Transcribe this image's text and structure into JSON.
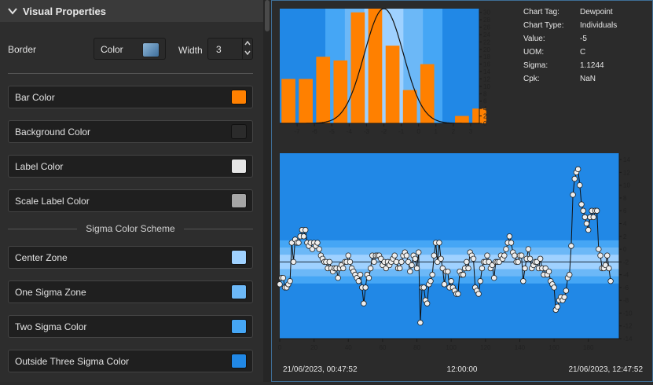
{
  "panel": {
    "title": "Visual Properties",
    "border_label": "Border",
    "border_type": "Color",
    "width_label": "Width",
    "width_value": "3"
  },
  "colors": [
    {
      "label": "Bar Color",
      "color": "#ff8000"
    },
    {
      "label": "Background Color",
      "color": "#2b2b2b"
    },
    {
      "label": "Label Color",
      "color": "#e6e6e6"
    },
    {
      "label": "Scale Label Color",
      "color": "#a6a6a6"
    }
  ],
  "sigma_section": "Sigma Color Scheme",
  "sigma_colors": [
    {
      "label": "Center Zone",
      "color": "#9fd1ff"
    },
    {
      "label": "One Sigma Zone",
      "color": "#6cb8f7"
    },
    {
      "label": "Two Sigma Color",
      "color": "#45a6f5"
    },
    {
      "label": "Outside Three Sigma Color",
      "color": "#2188e6"
    }
  ],
  "info": [
    {
      "key": "Chart Tag:",
      "value": "Dewpoint"
    },
    {
      "key": "Chart Type:",
      "value": "Individuals"
    },
    {
      "key": "Value:",
      "value": "-5"
    },
    {
      "key": "UOM:",
      "value": "C"
    },
    {
      "key": "Sigma:",
      "value": "1.1244"
    },
    {
      "key": "Cpk:",
      "value": "NaN"
    }
  ],
  "time_labels": [
    "21/06/2023, 00:47:52",
    "12:00:00",
    "21/06/2023, 12:47:52"
  ],
  "chart_data": [
    {
      "type": "bar",
      "categories": [
        "-7.5",
        "-6.5",
        "-5.5",
        "-4.5",
        "-3.5",
        "-2.5",
        "-1.5",
        "-0.5",
        "0.5",
        "1.5",
        "2.5",
        "3.5"
      ],
      "values": [
        12,
        12,
        18,
        17,
        30,
        31,
        21,
        9,
        16,
        0,
        2,
        4
      ],
      "x_ticks": [
        -7,
        -6,
        -5,
        -4,
        -3,
        -2,
        -1,
        0,
        1,
        2,
        3
      ],
      "y_ticks": [
        0,
        2,
        4,
        6,
        8,
        10,
        12,
        14,
        16,
        18,
        20,
        22,
        24,
        26,
        28,
        30
      ],
      "xlim": [
        -8,
        3.5
      ],
      "ylim": [
        0,
        31
      ],
      "normal_curve": {
        "mean": -2,
        "sigma": 1.1244,
        "peak": 31
      },
      "bar_color": "#ff8000"
    },
    {
      "type": "line",
      "x_ticks": [
        0,
        20,
        40,
        60,
        80,
        100,
        120,
        140,
        160,
        180
      ],
      "y_ticks": [
        14,
        12,
        10,
        8,
        6,
        4,
        2,
        0,
        -2,
        -4,
        -6,
        -8,
        -10,
        -12,
        -14
      ],
      "xlim": [
        0,
        198
      ],
      "ylim": [
        -14,
        15
      ],
      "center_line": -2,
      "sigma": 1.1244,
      "y": [
        -5.5,
        -4.5,
        -4.5,
        -6,
        -6,
        -5.5,
        -5,
        1,
        -2,
        1.5,
        1,
        1,
        2,
        3,
        2,
        3,
        1,
        0.5,
        1,
        0,
        1,
        0.5,
        1,
        0,
        -1,
        -1.5,
        -2,
        -2,
        -3,
        -2,
        -3,
        -3.5,
        -3,
        -3,
        -4.5,
        -3,
        -2.5,
        -3,
        -2,
        -2,
        -1,
        -2,
        -3,
        -3.5,
        -4,
        -4.5,
        -5,
        -4,
        -6,
        -8.5,
        -6,
        -4,
        -4.5,
        -3,
        -1,
        -2,
        -1,
        -1,
        -1,
        -1.5,
        -2.5,
        -2,
        -3,
        -2,
        -2.5,
        -2,
        -1.5,
        -1,
        -2,
        -3,
        -3,
        -2,
        -1,
        -0.5,
        -1,
        -2,
        -3.5,
        -2.5,
        -1,
        -1.5,
        -3,
        -0.5,
        -11.5,
        -6,
        -6,
        -8,
        -8.5,
        -5.5,
        -5,
        -4,
        -1,
        1,
        -2,
        1,
        -1.5,
        -3,
        -5.5,
        -3.5,
        -3.5,
        -6,
        -5,
        -6,
        -6.5,
        -7,
        -7,
        -3.5,
        -4,
        -4,
        -3,
        -2,
        -3,
        -0.5,
        -1,
        -1.5,
        -6,
        -6.5,
        -7,
        -5,
        -3,
        -2,
        -2,
        -1,
        -2,
        -3,
        -2.5,
        -4.5,
        -2,
        -2,
        -2,
        -1,
        -1.5,
        -1,
        0,
        1,
        2,
        1,
        -0.5,
        -1,
        -2,
        -2,
        -1,
        -1,
        -5,
        -3,
        -1.5,
        0,
        -1.5,
        -3,
        -2.5,
        -2,
        -2,
        -3,
        -1.5,
        -3,
        -4,
        -3,
        -4,
        -3.5,
        -5,
        -5.5,
        -6,
        -9.5,
        -9,
        -8,
        -7.5,
        -8,
        -7.5,
        -6.5,
        -4.5,
        -4,
        0.5,
        8.5,
        11,
        12,
        12.5,
        10,
        7,
        6,
        5,
        4,
        3,
        5,
        6,
        5,
        6,
        6,
        0,
        -1,
        -3,
        -3,
        -2.5,
        -1,
        -3,
        -5
      ]
    }
  ]
}
